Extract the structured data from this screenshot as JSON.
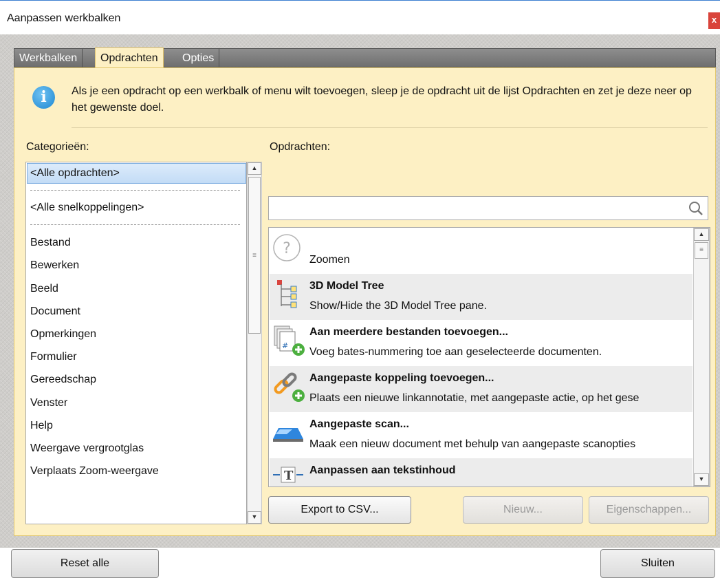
{
  "window": {
    "title": "Aanpassen werkbalken",
    "close_label": "x"
  },
  "tabs": [
    {
      "label": "Werkbalken"
    },
    {
      "label": "Opdrachten"
    },
    {
      "label": "Opties"
    }
  ],
  "info": {
    "icon": "info-icon",
    "text": "Als je een opdracht op een werkbalk of menu wilt toevoegen, sleep je de opdracht uit de lijst Opdrachten en zet je deze neer op het gewenste doel."
  },
  "categories": {
    "label": "Categorieën:",
    "selected": "<Alle opdrachten>",
    "shortcuts": "<Alle snelkoppelingen>",
    "items": [
      "Bestand",
      "Bewerken",
      "Beeld",
      "Document",
      "Opmerkingen",
      "Formulier",
      "Gereedschap",
      "Venster",
      "Help",
      "Weergave vergrootglas",
      "Verplaats Zoom-weergave"
    ]
  },
  "commands": {
    "label": "Opdrachten:",
    "search_placeholder": "",
    "items": [
      {
        "title": "",
        "desc": "Zoomen",
        "icon": "question-circle-icon"
      },
      {
        "title": "3D Model Tree",
        "desc": "Show/Hide the 3D Model Tree pane.",
        "icon": "tree-icon"
      },
      {
        "title": "Aan meerdere bestanden toevoegen...",
        "desc": "Voeg bates-nummering toe aan geselecteerde documenten.",
        "icon": "bates-add-icon"
      },
      {
        "title": "Aangepaste koppeling toevoegen...",
        "desc": "Plaats een nieuwe linkannotatie, met aangepaste actie, op het gese",
        "icon": "link-add-icon"
      },
      {
        "title": "Aangepaste scan...",
        "desc": "Maak een nieuw document met behulp van aangepaste scanopties",
        "icon": "scanner-icon"
      },
      {
        "title": "Aanpassen aan tekstinhoud",
        "desc": "",
        "icon": "fit-text-icon"
      }
    ]
  },
  "buttons": {
    "export": "Export to CSV...",
    "new": "Nieuw...",
    "properties": "Eigenschappen...",
    "reset": "Reset alle",
    "close": "Sluiten"
  }
}
